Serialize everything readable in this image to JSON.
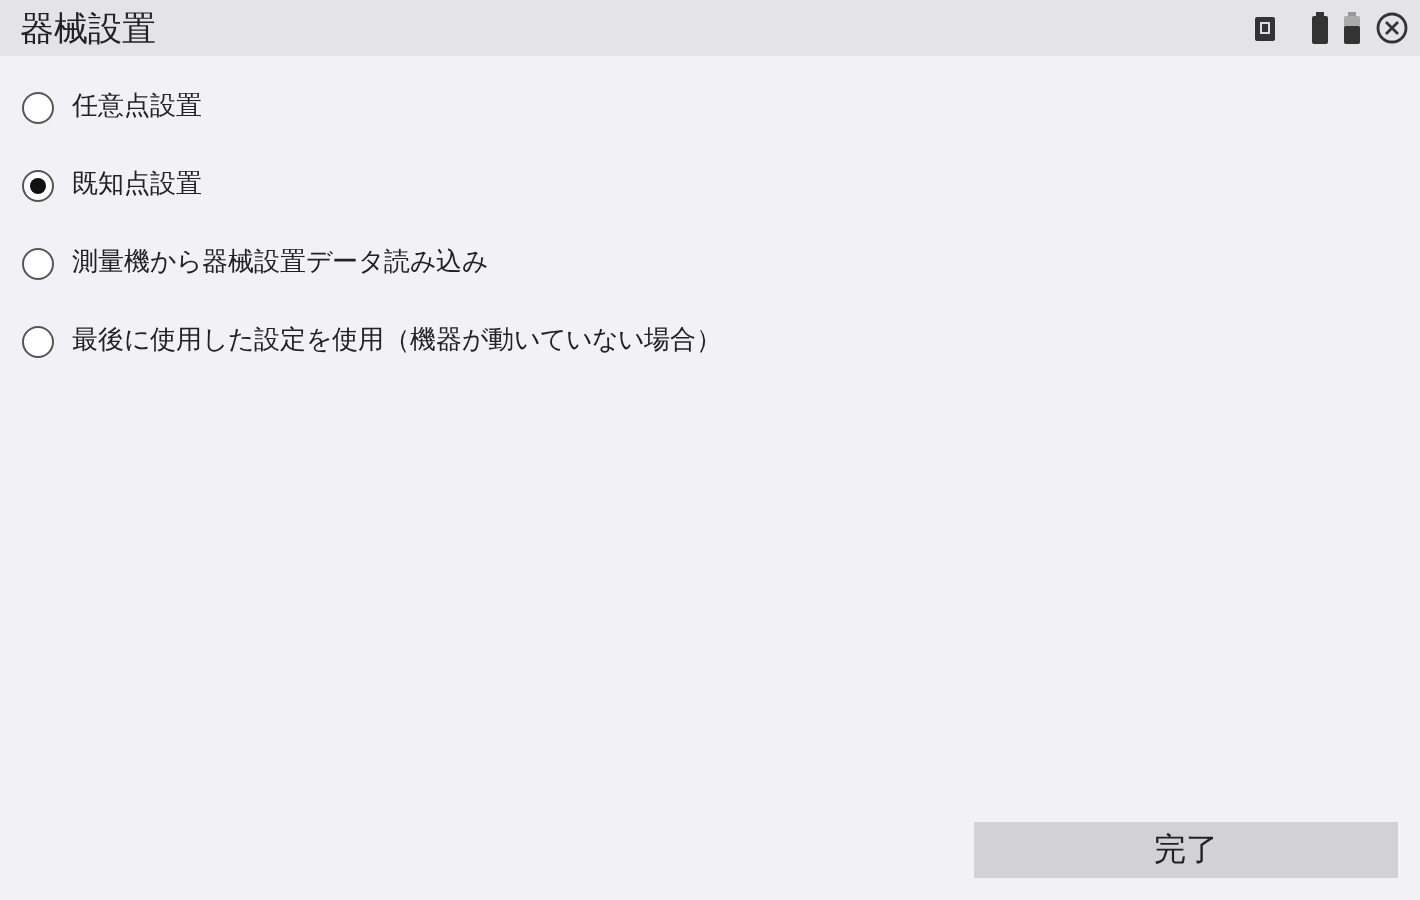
{
  "window": {
    "title": "器械設置"
  },
  "options": [
    {
      "label": "任意点設置",
      "selected": false
    },
    {
      "label": "既知点設置",
      "selected": true
    },
    {
      "label": "測量機から器械設置データ読み込み",
      "selected": false
    },
    {
      "label": "最後に使用した設定を使用（機器が動いていない場合）",
      "selected": false
    }
  ],
  "buttons": [
    "完了"
  ]
}
